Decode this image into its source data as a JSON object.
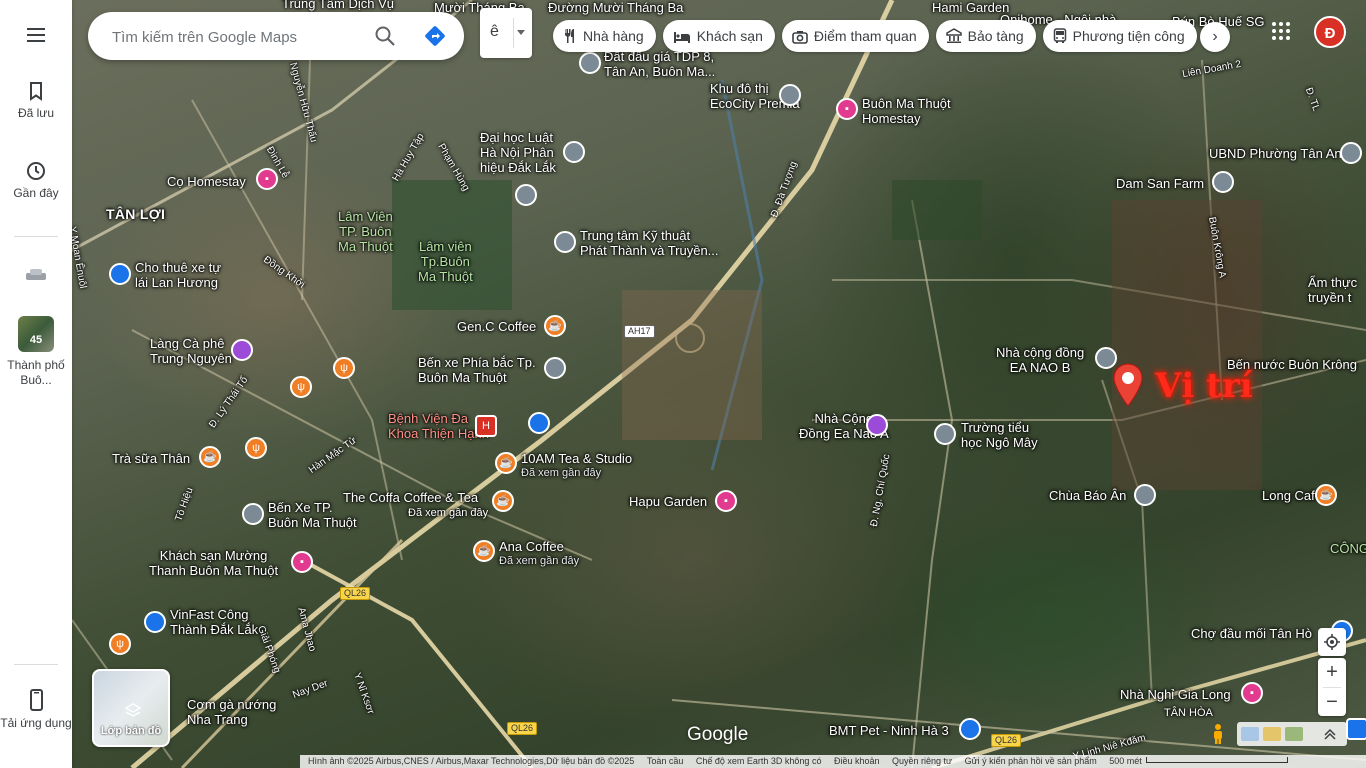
{
  "rail": {
    "menu": "menu-icon",
    "saved": "Đã lưu",
    "recent": "Gần đây",
    "city_badge": "45",
    "city_label": "Thành phố Buô...",
    "apps_label": "Tải ứng dụng"
  },
  "search": {
    "placeholder": "Tìm kiếm trên Google Maps",
    "ime_char": "ê"
  },
  "chips": [
    {
      "label": "Nhà hàng",
      "icon": "fork-knife-icon"
    },
    {
      "label": "Khách sạn",
      "icon": "bed-icon"
    },
    {
      "label": "Điểm tham quan",
      "icon": "camera-icon"
    },
    {
      "label": "Bảo tàng",
      "icon": "museum-icon"
    },
    {
      "label": "Phương tiện công",
      "icon": "bus-icon"
    }
  ],
  "account": {
    "initial": "Đ",
    "color": "#d93025"
  },
  "marker": {
    "label": "Vị trí",
    "color": "#ff2a1a"
  },
  "places": {
    "trung_tam_dich_vu": "Trung Tâm Dịch Vụ",
    "muoi_thang_ba": "Mười Tháng Ba",
    "duong_muoi_thang_ba": "Đường Mười Tháng Ba",
    "onihome": "Onihome - Ngôi nhà",
    "hami_garden": "Hami Garden",
    "bun_bo_hue": "Bún Bò Huế SG",
    "dat_dau_gia": "Đất đấu giá TDP 8,",
    "dat_dau_gia_2": "Tân An, Buôn Ma...",
    "khu_do_thi": "Khu đô thị",
    "ecocity": "EcoCity Premia",
    "bmt_homestay": "Buôn Ma Thuột",
    "bmt_homestay_2": "Homestay",
    "dai_hoc_luat": "Đại học Luật",
    "dai_hoc_luat_2": "Hà Nội Phân",
    "dai_hoc_luat_3": "hiệu Đắk Lắk",
    "ubnd": "UBND Phường Tân An",
    "dam_san_farm": "Dam San Farm",
    "co_homestay": "Cọ Homestay",
    "tan_loi": "TÂN LỢI",
    "lam_vien_1": "Lâm Viên",
    "lam_vien_1b": "TP. Buôn",
    "lam_vien_1c": "Ma Thuột",
    "lam_vien_2": "Lâm viên",
    "lam_vien_2b": "Tp.Buôn",
    "lam_vien_2c": "Ma Thuột",
    "trung_tam_ky_thuat": "Trung tâm Kỹ thuật",
    "trung_tam_ky_thuat_2": "Phát Thành và Truyền...",
    "cho_thue_xe": "Cho thuê xe tự",
    "cho_thue_xe_2": "lái Lan Hương",
    "gen_c_coffee": "Gen.C Coffee",
    "am_thuc": "Ẩm thực",
    "am_thuc_2": "truyền t",
    "lang_ca_phe": "Làng Cà phê",
    "lang_ca_phe_2": "Trung Nguyên",
    "ben_xe_phia_bac": "Bến xe Phía bắc Tp.",
    "ben_xe_phia_bac_2": "Buôn Ma Thuột",
    "nha_cong_dong_b": "Nhà cộng đồng",
    "nha_cong_dong_b_2": "EA NAO B",
    "ben_nuoc": "Bến nước Buôn Krông",
    "benh_vien": "Bệnh Viện Đa",
    "benh_vien_2": "Khoa Thiện Hạnh",
    "nha_cong_dong_a": "Nhà Cộng",
    "nha_cong_dong_a_2": "Đồng Ea Nao A",
    "truong_tieu_hoc": "Trường tiểu",
    "truong_tieu_hoc_2": "học Ngô Mây",
    "tra_sua": "Trà sữa Thân",
    "tea_studio": "10AM Tea & Studio",
    "tea_studio_sub": "Đã xem gần đây",
    "coffa": "The Coffa Coffee & Tea",
    "coffa_sub": "Đã xem gần đây",
    "hapu": "Hapu Garden",
    "chua_bao_an": "Chùa Báo Ân",
    "long_cafe": "Long Cafe",
    "ben_xe_tp": "Bến Xe TP.",
    "ben_xe_tp_2": "Buôn Ma Thuột",
    "ana_coffee": "Ana Coffee",
    "ana_coffee_sub": "Đã xem gần đây",
    "cong": "CÔNG",
    "khach_san_muong": "Khách sạn Mường",
    "khach_san_muong_2": "Thanh Buôn Ma Thuột",
    "vinfast": "VinFast Công",
    "vinfast_2": "Thành Đắk Lắk",
    "cho_dau_moi": "Chợ đầu mối Tân Hò",
    "com_ga": "Cơm gà nướng",
    "com_ga_2": "Nha Trang",
    "nha_nghi": "Nhà Nghỉ Gia Long",
    "tan_hoa": "TÂN HÒA",
    "bmt_pet": "BMT Pet - Ninh Hà 3"
  },
  "roads": {
    "ha_huy_tap": "Hà Huy Tập",
    "pham_hung": "Phạm Hùng",
    "dinh_le": "Đinh Lễ",
    "nguyen_huu_thau": "Nguyễn Hữu Thấu",
    "dong_khoi": "Đồng Khởi",
    "y_moan_enuol": "Y Moan Ênuôl",
    "ly_thai_to": "Đ. Lý Thái Tổ",
    "han_mac_tu": "Hàn Mặc Tử",
    "to_hien": "Tô Hiệu",
    "da_tuong": "Đ. Đà Tượng",
    "chi_quoc": "Đ. Ng. Chí Quốc",
    "buon_krong_a": "Buôn Krông A",
    "lien_doan_2": "Liên Doanh 2",
    "d_tl": "Đ. TL",
    "amajhao": "Ama Jhao",
    "nay_der": "Nay Der",
    "y_ni_ksor": "Y Nỉ Ksơr",
    "giai_phong": "Giải Phóng",
    "y_linh_nie_kdam": "Y Linh Niê Kđăm",
    "ah17": "AH17",
    "ql26a": "QL26",
    "ql26b": "QL26",
    "ql26c": "QL26"
  },
  "map_ui": {
    "layers_label": "Lớp bản đồ",
    "google": "Google",
    "zoom_in": "+",
    "zoom_out": "−"
  },
  "footer": {
    "imagery": "Hình ảnh ©2025 Airbus,CNES / Airbus,Maxar Technologies,Dữ liệu bản đồ ©2025",
    "global": "Toàn cầu",
    "earth3d": "Chế độ xem Earth 3D không có",
    "terms": "Điều khoản",
    "privacy": "Quyền riêng tư",
    "feedback": "Gửi ý kiến phản hồi về sản phẩm",
    "scale": "500 mét"
  }
}
